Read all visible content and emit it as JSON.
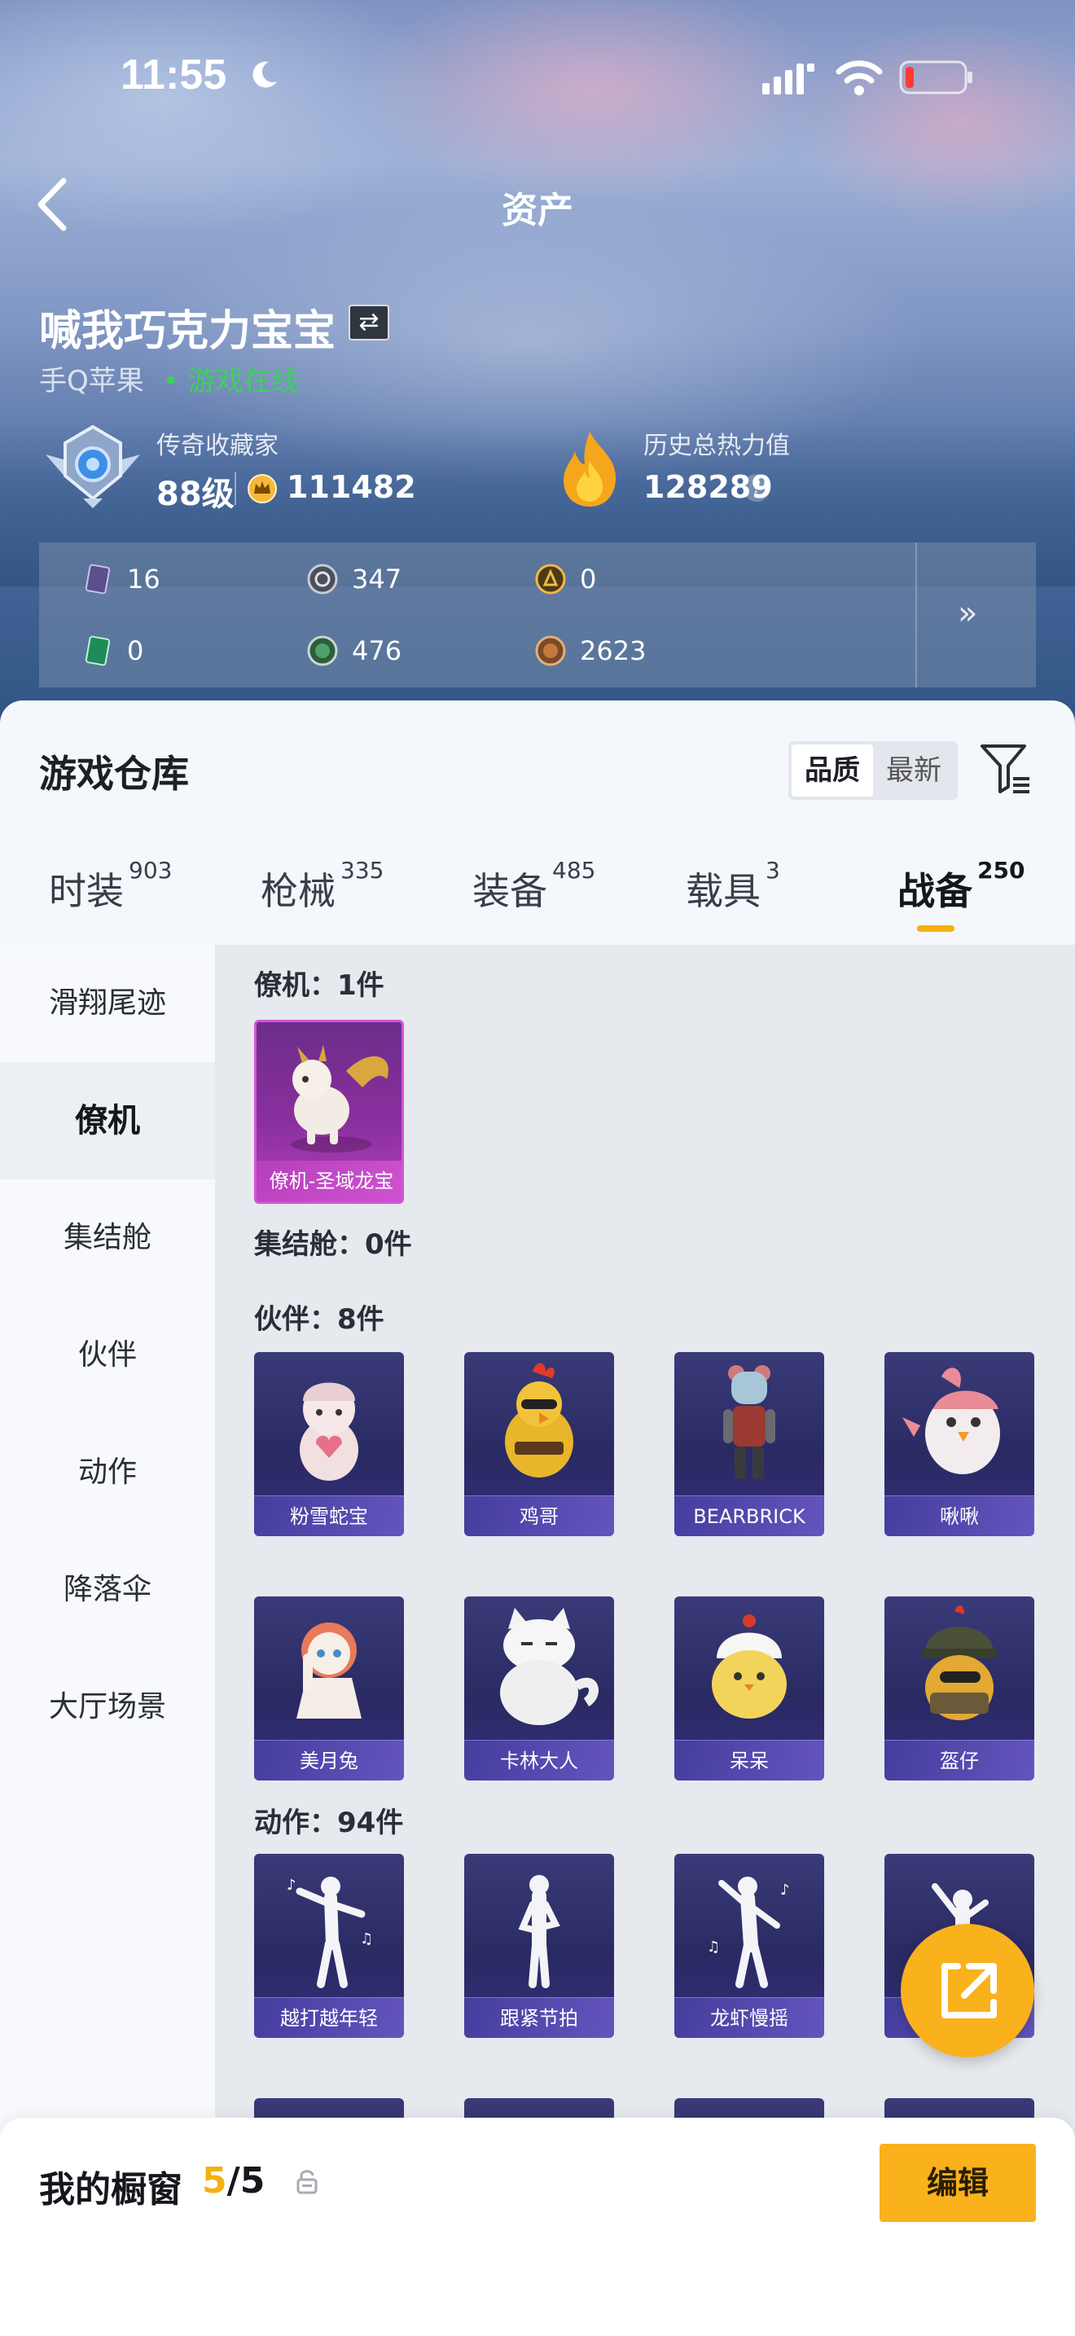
{
  "status_bar": {
    "time": "11:55"
  },
  "nav": {
    "title": "资产"
  },
  "profile": {
    "name": "喊我巧克力宝宝",
    "platform": "手Q苹果",
    "online_status": "• 游戏在线",
    "badge_title": "传奇收藏家",
    "level": "88级",
    "score": "111482",
    "heat_title": "历史总热力值",
    "heat_value": "128289",
    "help": "?"
  },
  "currencies": [
    {
      "icon": "purple-card-icon",
      "value": "16"
    },
    {
      "icon": "gray-coin-icon",
      "value": "347"
    },
    {
      "icon": "gold-coin-icon",
      "value": "0"
    },
    {
      "icon": "green-card-icon",
      "value": "0"
    },
    {
      "icon": "green-coin-icon",
      "value": "476"
    },
    {
      "icon": "bronze-coin-icon",
      "value": "2623"
    }
  ],
  "expand_label": "»",
  "warehouse": {
    "title": "游戏仓库",
    "sort_options": [
      "品质",
      "最新"
    ],
    "active_sort": "品质"
  },
  "tabs": [
    {
      "label": "时装",
      "count": "903"
    },
    {
      "label": "枪械",
      "count": "335"
    },
    {
      "label": "装备",
      "count": "485"
    },
    {
      "label": "载具",
      "count": "3"
    },
    {
      "label": "战备",
      "count": "250"
    }
  ],
  "active_tab": "战备",
  "sidebar": [
    "滑翔尾迹",
    "僚机",
    "集结舱",
    "伙伴",
    "动作",
    "降落伞",
    "大厅场景"
  ],
  "active_sidebar": "僚机",
  "sections": {
    "wingman": {
      "label": "僚机：1件",
      "items": [
        "僚机-圣域龙宝"
      ]
    },
    "pod": {
      "label": "集结舱：0件"
    },
    "partner": {
      "label": "伙伴：8件",
      "items": [
        "粉雪蛇宝",
        "鸡哥",
        "BEARBRICK",
        "啾啾",
        "美月兔",
        "卡林大人",
        "呆呆",
        "盔仔"
      ]
    },
    "action": {
      "label": "动作：94件",
      "items": [
        "越打越年轻",
        "跟紧节拍",
        "龙虾慢摇",
        ""
      ]
    }
  },
  "showcase": {
    "title": "我的橱窗",
    "current": "5",
    "separator": "/",
    "total": "5",
    "edit_label": "编辑"
  },
  "colors": {
    "accent": "#f9b11c",
    "online": "#3fcf5e",
    "card_purple": "#d354d8"
  }
}
